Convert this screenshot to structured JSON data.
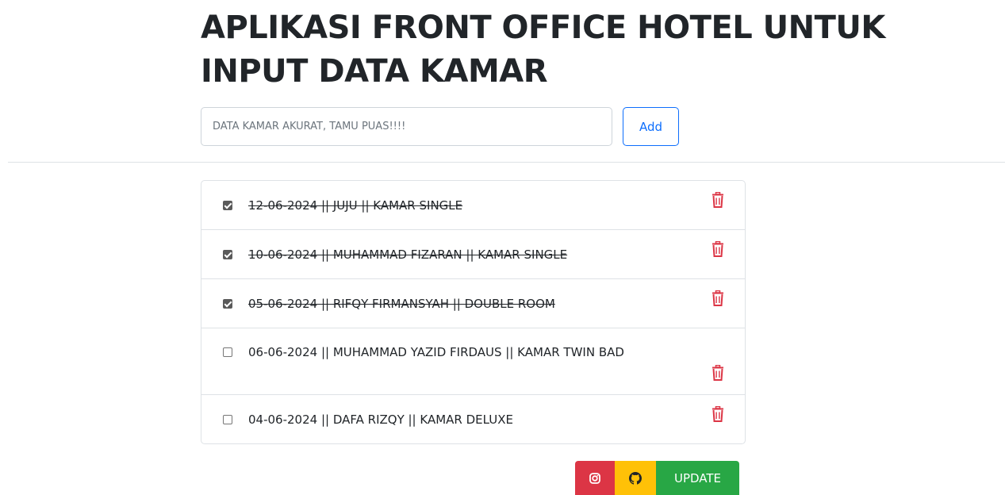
{
  "header": {
    "title": "APLIKASI FRONT OFFICE HOTEL UNTUK INPUT DATA KAMAR"
  },
  "form": {
    "placeholder": "DATA KAMAR AKURAT, TAMU PUAS!!!!",
    "value": "",
    "add_label": "Add"
  },
  "items": [
    {
      "text": "12-06-2024 || JUJU || KAMAR SINGLE",
      "done": true
    },
    {
      "text": "10-06-2024 || MUHAMMAD FIZARAN || KAMAR SINGLE",
      "done": true
    },
    {
      "text": "05-06-2024 || RIFQY FIRMANSYAH || DOUBLE ROOM",
      "done": true
    },
    {
      "text": "06-06-2024 || MUHAMMAD YAZID FIRDAUS || KAMAR TWIN BAD",
      "done": false
    },
    {
      "text": "04-06-2024 || DAFA RIZQY || KAMAR DELUXE",
      "done": false
    }
  ],
  "footer": {
    "instagram_icon": "instagram-icon",
    "github_icon": "github-icon",
    "update_label": "UPDATE"
  },
  "colors": {
    "primary": "#0d6efd",
    "danger": "#dc3545",
    "warning": "#ffc107",
    "success": "#28a745"
  }
}
